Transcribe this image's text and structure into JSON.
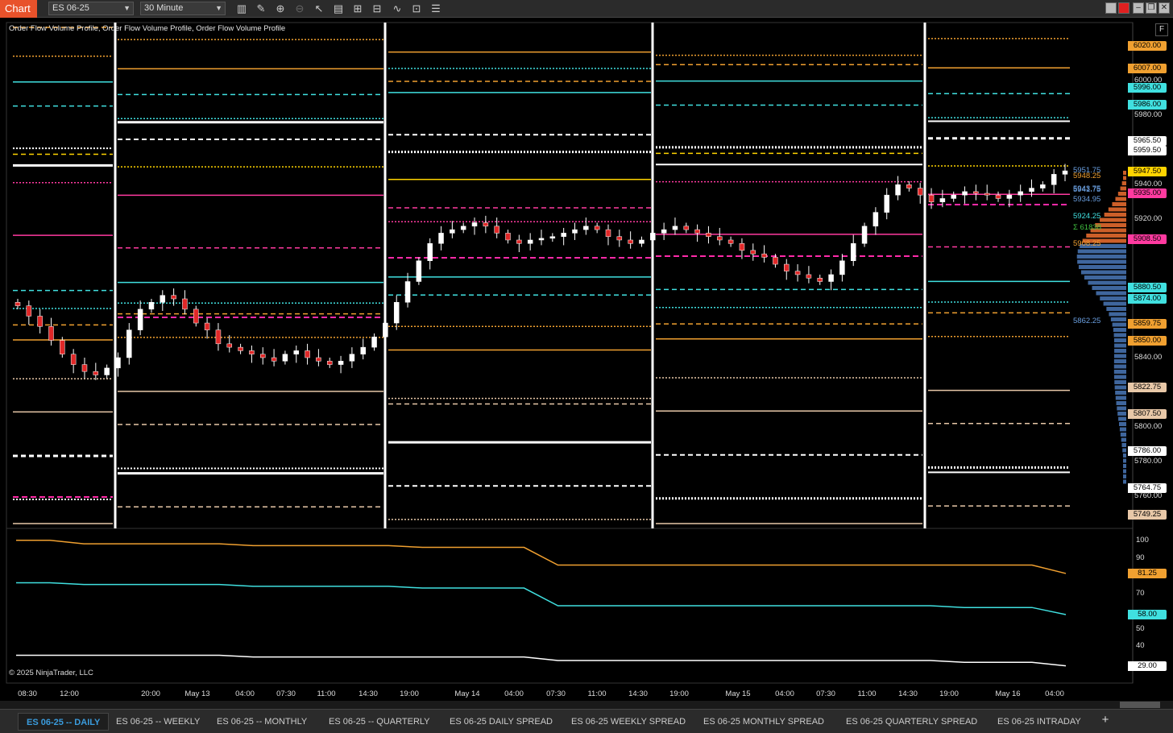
{
  "toolbar": {
    "app_title": "Chart",
    "instrument": "ES 06-25",
    "interval": "30 Minute"
  },
  "indicator_label": "Order Flow Volume Profile, Order Flow Volume Profile, Order Flow Volume Profile",
  "copyright": "© 2025 NinjaTrader, LLC",
  "f_button": "F",
  "tabs": [
    {
      "label": "ES 06-25 -- DAILY",
      "active": true
    },
    {
      "label": "ES 06-25 -- WEEKLY",
      "active": false
    },
    {
      "label": "ES 06-25 -- MONTHLY",
      "active": false
    },
    {
      "label": "ES 06-25 -- QUARTERLY",
      "active": false
    },
    {
      "label": "ES 06-25 DAILY SPREAD",
      "active": false
    },
    {
      "label": "ES 06-25 WEEKLY SPREAD",
      "active": false
    },
    {
      "label": "ES 06-25 MONTHLY SPREAD",
      "active": false
    },
    {
      "label": "ES 06-25 QUARTERLY SPREAD",
      "active": false
    },
    {
      "label": "ES 06-25 INTRADAY",
      "active": false
    }
  ],
  "add_tab": "+",
  "chart_data": [
    {
      "type": "candlestick",
      "title": "",
      "x_tick_labels": [
        "08:30",
        "12:00",
        "20:00",
        "May 13",
        "04:00",
        "07:30",
        "11:00",
        "14:30",
        "19:00",
        "May 14",
        "04:00",
        "07:30",
        "11:00",
        "14:30",
        "19:00",
        "May 15",
        "04:00",
        "07:30",
        "11:00",
        "14:30",
        "19:00",
        "May 16",
        "04:00"
      ],
      "y_axis_plain_labels": [
        "6000.00",
        "5980.00",
        "5940.00",
        "5920.00",
        "5840.00",
        "5800.00",
        "5780.00",
        "5760.00"
      ],
      "ylim": [
        5745,
        6030
      ],
      "price_markers": [
        {
          "label": "6020.00",
          "color": "#f0a030"
        },
        {
          "label": "6007.00",
          "color": "#f0a030"
        },
        {
          "label": "5996.00",
          "color": "#40e0e0"
        },
        {
          "label": "5986.00",
          "color": "#40e0e0"
        },
        {
          "label": "5965.50",
          "color": "#ffffff"
        },
        {
          "label": "5959.50",
          "color": "#ffffff"
        },
        {
          "label": "5947.50",
          "color": "#ffd400"
        },
        {
          "label": "5935.00",
          "color": "#ff3aa0"
        },
        {
          "label": "5908.50",
          "color": "#ff3aa0"
        },
        {
          "label": "5880.50",
          "color": "#40e0e0"
        },
        {
          "label": "5874.00",
          "color": "#40e0e0"
        },
        {
          "label": "5859.75",
          "color": "#f0a030"
        },
        {
          "label": "5850.00",
          "color": "#f0a030"
        },
        {
          "label": "5822.75",
          "color": "#e8c8a8"
        },
        {
          "label": "5807.50",
          "color": "#e8c8a8"
        },
        {
          "label": "5786.00",
          "color": "#ffffff"
        },
        {
          "label": "5764.75",
          "color": "#ffffff"
        },
        {
          "label": "5749.25",
          "color": "#e8c8a8"
        }
      ],
      "profile_labels": [
        "5951.75",
        "5948.25",
        "5943.75",
        "5941.75",
        "5934.95",
        "5924.25",
        "Σ 61838",
        "5908.25",
        "5862.25"
      ],
      "closes": [
        5870,
        5864,
        5858,
        5850,
        5842,
        5836,
        5832,
        5830,
        5834,
        5840,
        5856,
        5868,
        5872,
        5876,
        5874,
        5868,
        5860,
        5856,
        5848,
        5846,
        5844,
        5842,
        5840,
        5838,
        5842,
        5844,
        5840,
        5838,
        5836,
        5838,
        5842,
        5846,
        5852,
        5860,
        5872,
        5884,
        5896,
        5906,
        5912,
        5914,
        5916,
        5918,
        5916,
        5912,
        5908,
        5906,
        5908,
        5909,
        5910,
        5912,
        5914,
        5916,
        5914,
        5910,
        5908,
        5906,
        5908,
        5912,
        5914,
        5916,
        5914,
        5912,
        5910,
        5908,
        5906,
        5902,
        5900,
        5898,
        5894,
        5890,
        5888,
        5886,
        5884,
        5888,
        5896,
        5906,
        5916,
        5924,
        5934,
        5940,
        5938,
        5934,
        5930,
        5932,
        5934,
        5936,
        5935,
        5934,
        5932,
        5934,
        5936,
        5938,
        5940,
        5946,
        5948
      ]
    },
    {
      "type": "line",
      "title": "",
      "y_axis_labels": [
        "100",
        "90",
        "70",
        "50",
        "40"
      ],
      "ylim": [
        22,
        104
      ],
      "series": [
        {
          "color": "#f0a030",
          "last_label": "81.25",
          "values": [
            100,
            100,
            98,
            98,
            98,
            98,
            98,
            97,
            97,
            97,
            97,
            97,
            96,
            96,
            96,
            96,
            86,
            86,
            86,
            86,
            86,
            86,
            86,
            86,
            86,
            86,
            86,
            86,
            86,
            86,
            86,
            81.25
          ]
        },
        {
          "color": "#40e0e0",
          "last_label": "58.00",
          "values": [
            76,
            76,
            75,
            75,
            75,
            75,
            75,
            74,
            74,
            74,
            74,
            74,
            73,
            73,
            73,
            73,
            63,
            63,
            63,
            63,
            63,
            63,
            63,
            63,
            63,
            63,
            63,
            63,
            62,
            62,
            62,
            58
          ]
        },
        {
          "color": "#ffffff",
          "last_label": "29.00",
          "values": [
            35,
            35,
            35,
            35,
            35,
            35,
            35,
            34,
            34,
            34,
            34,
            34,
            34,
            34,
            34,
            34,
            32,
            32,
            32,
            32,
            32,
            32,
            32,
            32,
            32,
            32,
            32,
            32,
            31,
            31,
            31,
            29
          ]
        }
      ]
    }
  ]
}
